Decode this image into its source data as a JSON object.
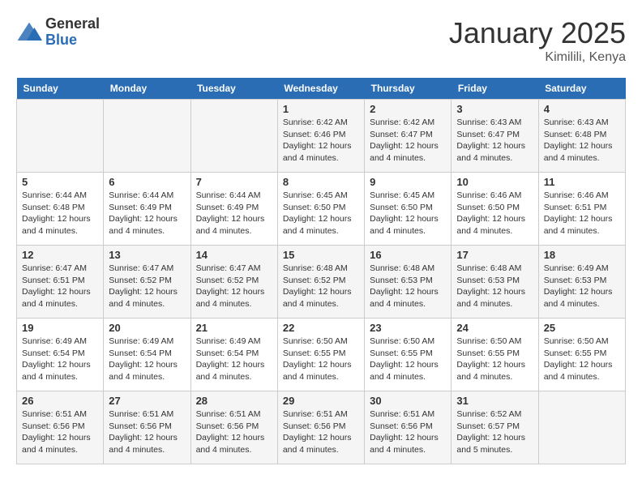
{
  "header": {
    "logo_general": "General",
    "logo_blue": "Blue",
    "title": "January 2025",
    "location": "Kimilili, Kenya"
  },
  "days_of_week": [
    "Sunday",
    "Monday",
    "Tuesday",
    "Wednesday",
    "Thursday",
    "Friday",
    "Saturday"
  ],
  "weeks": [
    [
      {
        "day": "",
        "info": ""
      },
      {
        "day": "",
        "info": ""
      },
      {
        "day": "",
        "info": ""
      },
      {
        "day": "1",
        "sunrise": "6:42 AM",
        "sunset": "6:46 PM",
        "daylight": "12 hours and 4 minutes."
      },
      {
        "day": "2",
        "sunrise": "6:42 AM",
        "sunset": "6:47 PM",
        "daylight": "12 hours and 4 minutes."
      },
      {
        "day": "3",
        "sunrise": "6:43 AM",
        "sunset": "6:47 PM",
        "daylight": "12 hours and 4 minutes."
      },
      {
        "day": "4",
        "sunrise": "6:43 AM",
        "sunset": "6:48 PM",
        "daylight": "12 hours and 4 minutes."
      }
    ],
    [
      {
        "day": "5",
        "sunrise": "6:44 AM",
        "sunset": "6:48 PM",
        "daylight": "12 hours and 4 minutes."
      },
      {
        "day": "6",
        "sunrise": "6:44 AM",
        "sunset": "6:49 PM",
        "daylight": "12 hours and 4 minutes."
      },
      {
        "day": "7",
        "sunrise": "6:44 AM",
        "sunset": "6:49 PM",
        "daylight": "12 hours and 4 minutes."
      },
      {
        "day": "8",
        "sunrise": "6:45 AM",
        "sunset": "6:50 PM",
        "daylight": "12 hours and 4 minutes."
      },
      {
        "day": "9",
        "sunrise": "6:45 AM",
        "sunset": "6:50 PM",
        "daylight": "12 hours and 4 minutes."
      },
      {
        "day": "10",
        "sunrise": "6:46 AM",
        "sunset": "6:50 PM",
        "daylight": "12 hours and 4 minutes."
      },
      {
        "day": "11",
        "sunrise": "6:46 AM",
        "sunset": "6:51 PM",
        "daylight": "12 hours and 4 minutes."
      }
    ],
    [
      {
        "day": "12",
        "sunrise": "6:47 AM",
        "sunset": "6:51 PM",
        "daylight": "12 hours and 4 minutes."
      },
      {
        "day": "13",
        "sunrise": "6:47 AM",
        "sunset": "6:52 PM",
        "daylight": "12 hours and 4 minutes."
      },
      {
        "day": "14",
        "sunrise": "6:47 AM",
        "sunset": "6:52 PM",
        "daylight": "12 hours and 4 minutes."
      },
      {
        "day": "15",
        "sunrise": "6:48 AM",
        "sunset": "6:52 PM",
        "daylight": "12 hours and 4 minutes."
      },
      {
        "day": "16",
        "sunrise": "6:48 AM",
        "sunset": "6:53 PM",
        "daylight": "12 hours and 4 minutes."
      },
      {
        "day": "17",
        "sunrise": "6:48 AM",
        "sunset": "6:53 PM",
        "daylight": "12 hours and 4 minutes."
      },
      {
        "day": "18",
        "sunrise": "6:49 AM",
        "sunset": "6:53 PM",
        "daylight": "12 hours and 4 minutes."
      }
    ],
    [
      {
        "day": "19",
        "sunrise": "6:49 AM",
        "sunset": "6:54 PM",
        "daylight": "12 hours and 4 minutes."
      },
      {
        "day": "20",
        "sunrise": "6:49 AM",
        "sunset": "6:54 PM",
        "daylight": "12 hours and 4 minutes."
      },
      {
        "day": "21",
        "sunrise": "6:49 AM",
        "sunset": "6:54 PM",
        "daylight": "12 hours and 4 minutes."
      },
      {
        "day": "22",
        "sunrise": "6:50 AM",
        "sunset": "6:55 PM",
        "daylight": "12 hours and 4 minutes."
      },
      {
        "day": "23",
        "sunrise": "6:50 AM",
        "sunset": "6:55 PM",
        "daylight": "12 hours and 4 minutes."
      },
      {
        "day": "24",
        "sunrise": "6:50 AM",
        "sunset": "6:55 PM",
        "daylight": "12 hours and 4 minutes."
      },
      {
        "day": "25",
        "sunrise": "6:50 AM",
        "sunset": "6:55 PM",
        "daylight": "12 hours and 4 minutes."
      }
    ],
    [
      {
        "day": "26",
        "sunrise": "6:51 AM",
        "sunset": "6:56 PM",
        "daylight": "12 hours and 4 minutes."
      },
      {
        "day": "27",
        "sunrise": "6:51 AM",
        "sunset": "6:56 PM",
        "daylight": "12 hours and 4 minutes."
      },
      {
        "day": "28",
        "sunrise": "6:51 AM",
        "sunset": "6:56 PM",
        "daylight": "12 hours and 4 minutes."
      },
      {
        "day": "29",
        "sunrise": "6:51 AM",
        "sunset": "6:56 PM",
        "daylight": "12 hours and 4 minutes."
      },
      {
        "day": "30",
        "sunrise": "6:51 AM",
        "sunset": "6:56 PM",
        "daylight": "12 hours and 4 minutes."
      },
      {
        "day": "31",
        "sunrise": "6:52 AM",
        "sunset": "6:57 PM",
        "daylight": "12 hours and 5 minutes."
      },
      {
        "day": "",
        "info": ""
      }
    ]
  ],
  "labels": {
    "sunrise": "Sunrise:",
    "sunset": "Sunset:",
    "daylight": "Daylight:"
  }
}
